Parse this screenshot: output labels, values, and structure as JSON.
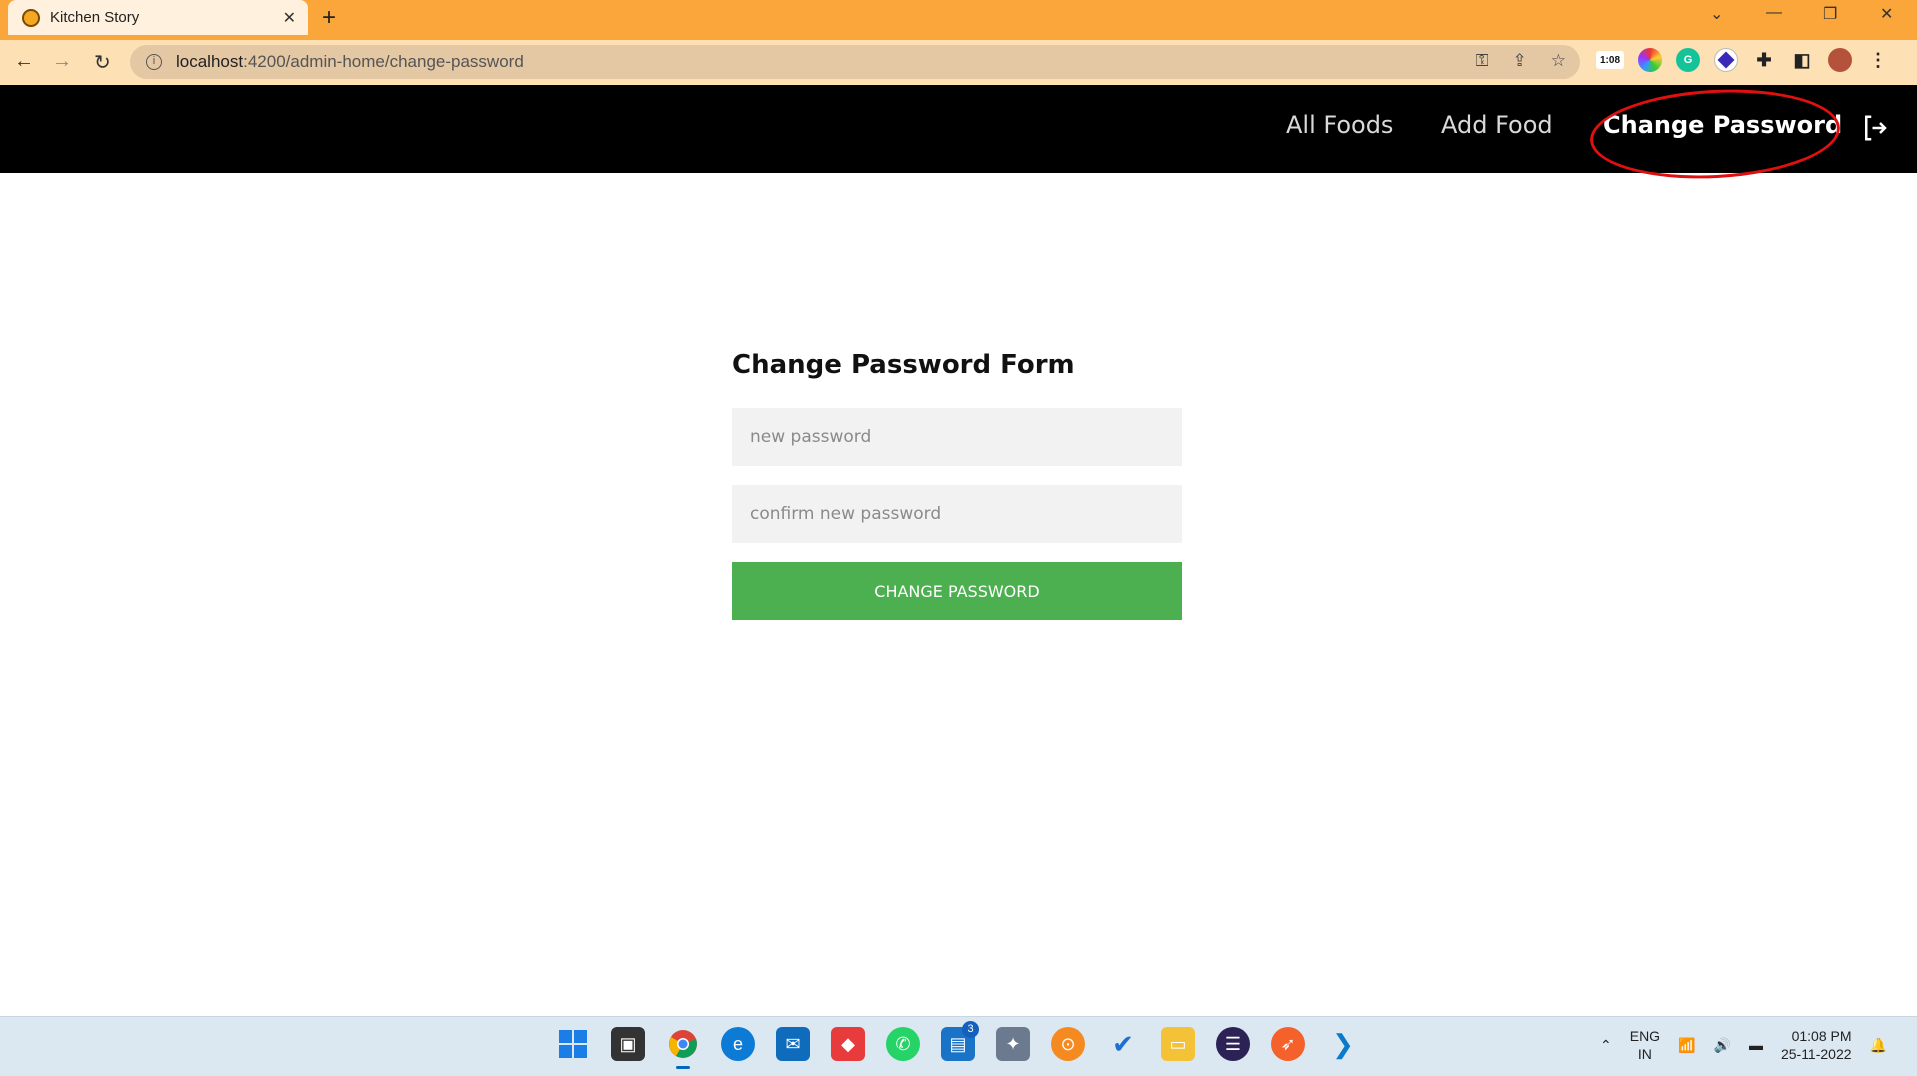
{
  "browser": {
    "tab_title": "Kitchen Story",
    "tab_close": "✕",
    "new_tab": "+",
    "url_host": "localhost",
    "url_path": ":4200/admin-home/change-password",
    "extension_timer": "1:08"
  },
  "nav": {
    "links": [
      "All Foods",
      "Add Food",
      "Change Password"
    ],
    "active": "Change Password"
  },
  "form": {
    "title": "Change Password Form",
    "new_password_placeholder": "new password",
    "confirm_password_placeholder": "confirm new password",
    "submit_label": "CHANGE PASSWORD"
  },
  "taskbar": {
    "badge_count": "3",
    "lang_line1": "ENG",
    "lang_line2": "IN",
    "time": "01:08 PM",
    "date": "25-11-2022"
  },
  "colors": {
    "browser_frame": "#fba63a",
    "nav_bg": "#000000",
    "button_green": "#4caf50",
    "annotation_red": "#e01010"
  }
}
